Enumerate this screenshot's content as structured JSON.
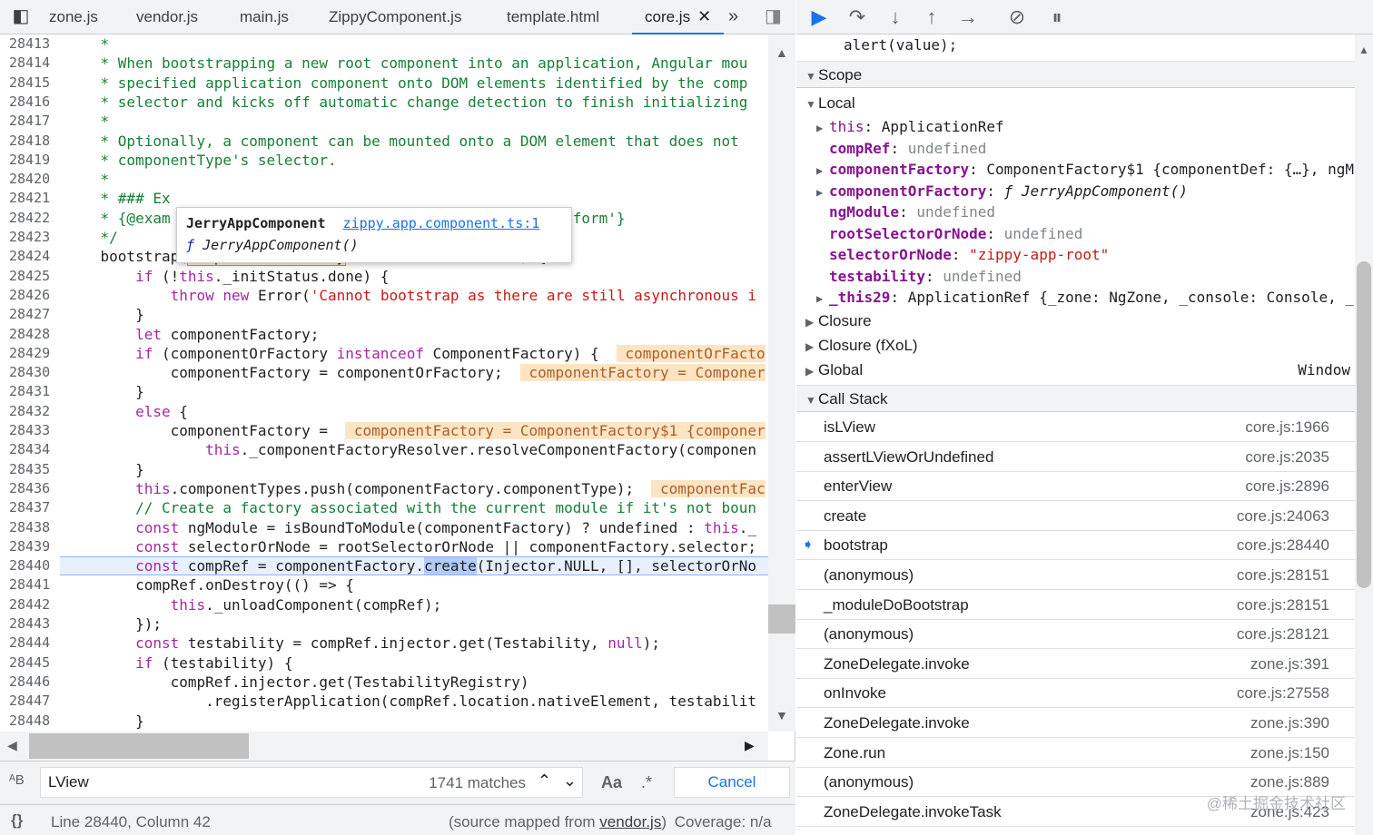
{
  "tabs": [
    {
      "label": "zone.js",
      "active": false
    },
    {
      "label": "vendor.js",
      "active": false
    },
    {
      "label": "main.js",
      "active": false
    },
    {
      "label": "ZippyComponent.js",
      "active": false
    },
    {
      "label": "template.html",
      "active": false
    },
    {
      "label": "core.js",
      "active": true
    }
  ],
  "tab_close": "✕",
  "tab_overflow": "»",
  "editor": {
    "lines": [
      {
        "n": "28413",
        "html": "<span class='cm'>    *</span>"
      },
      {
        "n": "28414",
        "html": "<span class='cm'>    * When bootstrapping a new root component into an application, Angular mou</span>"
      },
      {
        "n": "28415",
        "html": "<span class='cm'>    * specified application component onto DOM elements identified by the comp</span>"
      },
      {
        "n": "28416",
        "html": "<span class='cm'>    * selector and kicks off automatic change detection to finish initializing</span>"
      },
      {
        "n": "28417",
        "html": "<span class='cm'>    *</span>"
      },
      {
        "n": "28418",
        "html": "<span class='cm'>    * Optionally, a component can be mounted onto a DOM element that does not</span>"
      },
      {
        "n": "28419",
        "html": "<span class='cm'>    * componentType's selector.</span>"
      },
      {
        "n": "28420",
        "html": "<span class='cm'>    *</span>"
      },
      {
        "n": "28421",
        "html": "<span class='cm'>    * ### Ex</span>"
      },
      {
        "n": "28422",
        "html": "<span class='cm'>    * {@exam                                             gform'}</span>"
      },
      {
        "n": "28423",
        "html": "<span class='cm'>    */</span>"
      },
      {
        "n": "28424",
        "html": "    bootstrap(<span class='hlbox'>componentOrFactory</span>, rootSelectorOrNode) {"
      },
      {
        "n": "28425",
        "html": "        <span class='kw'>if</span> (!<span class='kw'>this</span>._initStatus.done) {"
      },
      {
        "n": "28426",
        "html": "            <span class='kw'>throw</span> <span class='kw'>new</span> Error(<span class='str'>'Cannot bootstrap as there are still asynchronous i</span>"
      },
      {
        "n": "28427",
        "html": "        }"
      },
      {
        "n": "28428",
        "html": "        <span class='kw'>let</span> componentFactory;"
      },
      {
        "n": "28429",
        "html": "        <span class='kw'>if</span> (componentOrFactory <span class='kw'>instanceof</span> ComponentFactory) {  <span class='inline'> componentOrFacto</span>"
      },
      {
        "n": "28430",
        "html": "            componentFactory = componentOrFactory;  <span class='inline'> componentFactory = Componer</span>"
      },
      {
        "n": "28431",
        "html": "        }"
      },
      {
        "n": "28432",
        "html": "        <span class='kw'>else</span> {"
      },
      {
        "n": "28433",
        "html": "            componentFactory =  <span class='inline'> componentFactory = ComponentFactory$1 {componer</span>"
      },
      {
        "n": "28434",
        "html": "                <span class='kw'>this</span>._componentFactoryResolver.resolveComponentFactory(componen"
      },
      {
        "n": "28435",
        "html": "        }"
      },
      {
        "n": "28436",
        "html": "        <span class='kw'>this</span>.componentTypes.push(componentFactory.componentType);  <span class='inline'> componentFac</span>"
      },
      {
        "n": "28437",
        "html": "<span class='cm'>        // Create a factory associated with the current module if it's not boun</span>"
      },
      {
        "n": "28438",
        "html": "        <span class='kw'>const</span> ngModule = isBoundToModule(componentFactory) ? undefined : <span class='kw'>this</span>._"
      },
      {
        "n": "28439",
        "html": "        <span class='kw'>const</span> selectorOrNode = rootSelectorOrNode || componentFactory.selector;"
      },
      {
        "n": "28440",
        "html": "        <span class='kw'>const</span> compRef = componentFactory.<span class='sel'>create</span>(Injector.NULL, [], selectorOrNo",
        "current": true
      },
      {
        "n": "28441",
        "html": "        compRef.onDestroy(() => {"
      },
      {
        "n": "28442",
        "html": "            <span class='kw'>this</span>._unloadComponent(compRef);"
      },
      {
        "n": "28443",
        "html": "        });"
      },
      {
        "n": "28444",
        "html": "        <span class='kw'>const</span> testability = compRef.injector.get(Testability, <span class='kw'>null</span>);"
      },
      {
        "n": "28445",
        "html": "        <span class='kw'>if</span> (testability) {"
      },
      {
        "n": "28446",
        "html": "            compRef.injector.get(TestabilityRegistry)"
      },
      {
        "n": "28447",
        "html": "                .registerApplication(compRef.location.nativeElement, testabilit"
      },
      {
        "n": "28448",
        "html": "        }"
      }
    ]
  },
  "tooltip": {
    "name": "JerryAppComponent",
    "link": "zippy.app.component.ts:1",
    "signature": "JerryAppComponent()",
    "f": "ƒ"
  },
  "search": {
    "value": "LView",
    "matches": "1741 matches",
    "case_label": "Aa",
    "regex_label": ".*",
    "cancel": "Cancel"
  },
  "status": {
    "position": "Line 28440, Column 42",
    "source_prefix": "(source mapped from ",
    "source_file": "vendor.js",
    "source_suffix": ")",
    "coverage": "Coverage: n/a"
  },
  "debugger": {
    "watch_line": "alert(value);",
    "scope_title": "Scope",
    "local_title": "Local",
    "scope_rows": [
      {
        "tri": "▶",
        "name": "this",
        "sep": ": ",
        "value": "ApplicationRef",
        "kind": "obj",
        "bold": false
      },
      {
        "tri": "",
        "name": "compRef",
        "sep": ": ",
        "value": "undefined",
        "kind": "undef",
        "bold": true
      },
      {
        "tri": "▶",
        "name": "componentFactory",
        "sep": ": ",
        "value": "ComponentFactory$1 {componentDef: {…}, ngM",
        "kind": "obj",
        "bold": true
      },
      {
        "tri": "▶",
        "name": "componentOrFactory",
        "sep": ": ",
        "value": "ƒ JerryAppComponent()",
        "kind": "fn",
        "bold": true
      },
      {
        "tri": "",
        "name": "ngModule",
        "sep": ": ",
        "value": "undefined",
        "kind": "undef",
        "bold": true
      },
      {
        "tri": "",
        "name": "rootSelectorOrNode",
        "sep": ": ",
        "value": "undefined",
        "kind": "undef",
        "bold": true
      },
      {
        "tri": "",
        "name": "selectorOrNode",
        "sep": ": ",
        "value": "\"zippy-app-root\"",
        "kind": "str",
        "bold": true
      },
      {
        "tri": "",
        "name": "testability",
        "sep": ": ",
        "value": "undefined",
        "kind": "undef",
        "bold": true
      },
      {
        "tri": "▶",
        "name": "_this29",
        "sep": ": ",
        "value": "ApplicationRef {_zone: NgZone, _console: Console, _",
        "kind": "obj",
        "bold": true
      }
    ],
    "closure1": "Closure",
    "closure2": "Closure (fXoL)",
    "global": "Global",
    "global_val": "Window",
    "callstack_title": "Call Stack",
    "callstack": [
      {
        "name": "isLView",
        "loc": "core.js:1966",
        "current": false
      },
      {
        "name": "assertLViewOrUndefined",
        "loc": "core.js:2035",
        "current": false
      },
      {
        "name": "enterView",
        "loc": "core.js:2896",
        "current": false
      },
      {
        "name": "create",
        "loc": "core.js:24063",
        "current": false
      },
      {
        "name": "bootstrap",
        "loc": "core.js:28440",
        "current": true
      },
      {
        "name": "(anonymous)",
        "loc": "core.js:28151",
        "current": false
      },
      {
        "name": "_moduleDoBootstrap",
        "loc": "core.js:28151",
        "current": false
      },
      {
        "name": "(anonymous)",
        "loc": "core.js:28121",
        "current": false
      },
      {
        "name": "ZoneDelegate.invoke",
        "loc": "zone.js:391",
        "current": false
      },
      {
        "name": "onInvoke",
        "loc": "core.js:27558",
        "current": false
      },
      {
        "name": "ZoneDelegate.invoke",
        "loc": "zone.js:390",
        "current": false
      },
      {
        "name": "Zone.run",
        "loc": "zone.js:150",
        "current": false
      },
      {
        "name": "(anonymous)",
        "loc": "zone.js:889",
        "current": false
      },
      {
        "name": "ZoneDelegate.invokeTask",
        "loc": "zone.js:423",
        "current": false
      }
    ],
    "watermark": "@稀土掘金技术社区"
  },
  "colors": {
    "accent": "#1a73e8",
    "current_line": "#e8f0fe",
    "inline_value_bg": "#ffe4c4"
  }
}
